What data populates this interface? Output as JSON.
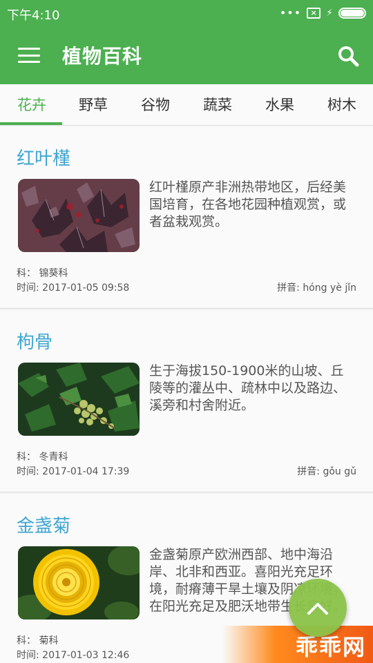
{
  "status_bar": {
    "time": "下午4:10",
    "signal_dots": "•••"
  },
  "app_bar": {
    "title": "植物百科"
  },
  "tabs": [
    {
      "label": "花卉"
    },
    {
      "label": "野草"
    },
    {
      "label": "谷物"
    },
    {
      "label": "蔬菜"
    },
    {
      "label": "水果"
    },
    {
      "label": "树木"
    }
  ],
  "active_tab": "花卉",
  "plants": [
    {
      "name": "红叶槿",
      "description": "红叶槿原产非洲热带地区，后经美国培育，在各地花园种植观赏，或者盆栽观赏。",
      "family": "科：  锦葵科",
      "time": "时间:  2017-01-05 09:58",
      "pinyin": "拼音:  hóng yè jǐn",
      "image": "red-leaf-hibiscus-photo"
    },
    {
      "name": "枸骨",
      "description": "生于海拔150-1900米的山坡、丘陵等的灌丛中、疏林中以及路边、溪旁和村舍附近。",
      "family": "科：  冬青科",
      "time": "时间:  2017-01-04 17:39",
      "pinyin": "拼音:  gǒu gǔ",
      "image": "holly-berries-photo"
    },
    {
      "name": "金盏菊",
      "description": "金盏菊原产欧洲西部、地中海沿岸、北非和西亚。喜阳光充足环境，耐瘠薄干旱土壤及阴凉环境，在阳光充足及肥沃地带生长良好。",
      "family": "科：  菊科",
      "time": "时间:  2017-01-03 12:46",
      "pinyin": "",
      "image": "marigold-flower-photo"
    }
  ],
  "watermark": {
    "text": "乖乖网"
  },
  "colors": {
    "primary": "#4caf50",
    "accent": "#8bc34a",
    "title_blue": "#3ea6d1"
  }
}
